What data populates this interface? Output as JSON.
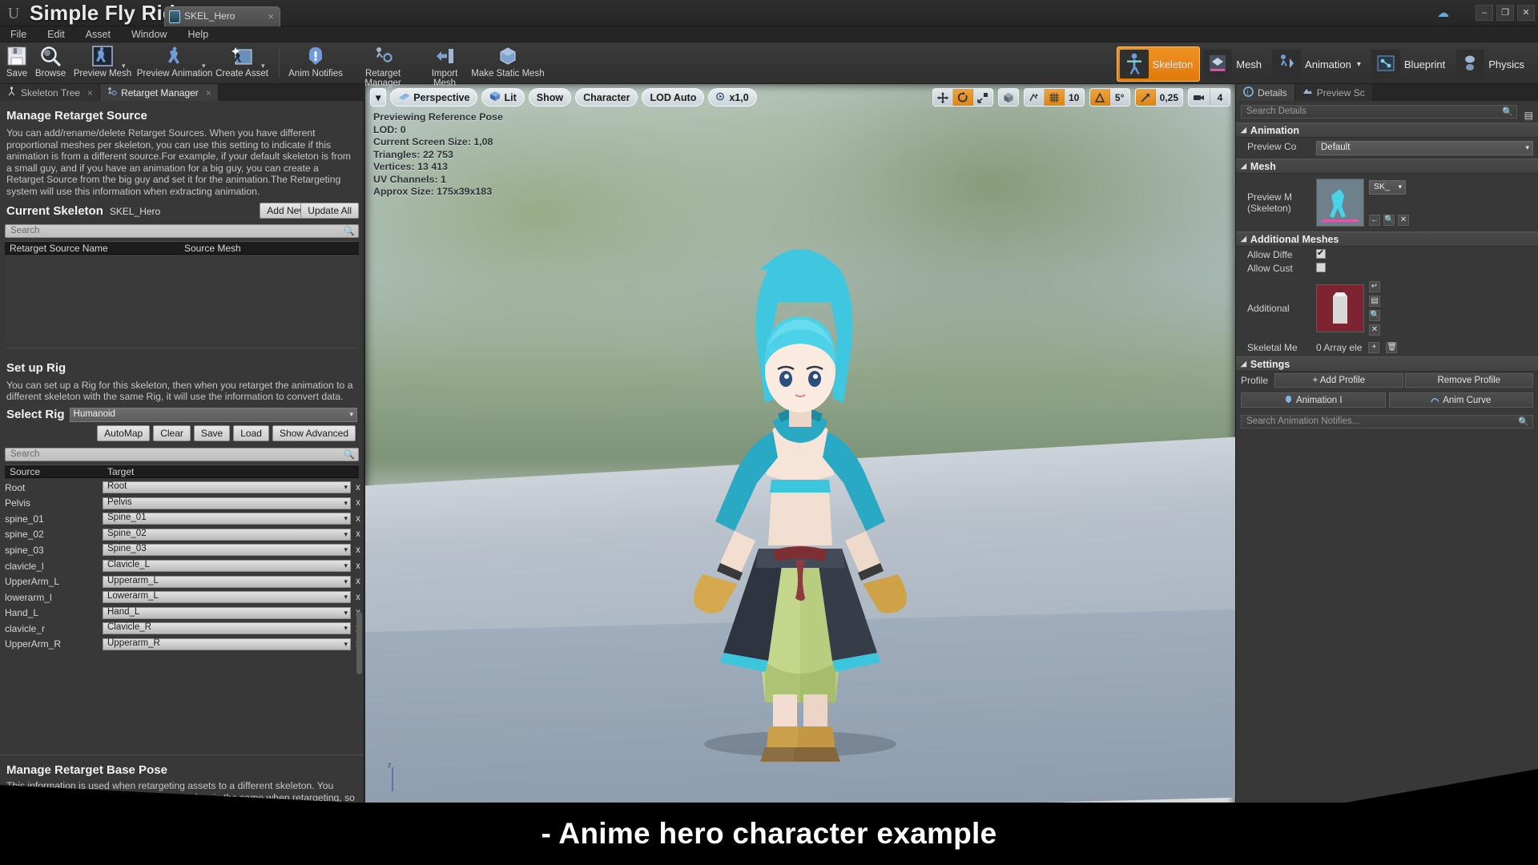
{
  "window": {
    "project_title": "Simple Fly Ride",
    "document_tab": "SKEL_Hero",
    "tab_close": "×",
    "cloud_icon": "cloud-icon",
    "minimize": "–",
    "maximize": "❐",
    "close": "✕"
  },
  "menu": {
    "items": [
      "File",
      "Edit",
      "Asset",
      "Window",
      "Help"
    ]
  },
  "toolbar": {
    "items": [
      {
        "label": "Save",
        "icon": "save-icon",
        "caret": false
      },
      {
        "label": "Browse",
        "icon": "browse-magnifier-icon",
        "caret": false
      },
      {
        "label": "Preview Mesh",
        "icon": "preview-mesh-icon",
        "caret": true
      },
      {
        "label": "Preview Animation",
        "icon": "preview-animation-icon",
        "caret": true
      },
      {
        "label": "Create Asset",
        "icon": "create-asset-icon",
        "caret": true
      },
      {
        "label": "Anim Notifies",
        "icon": "anim-notifies-icon",
        "caret": false
      },
      {
        "label": "Retarget Manager",
        "icon": "retarget-manager-icon",
        "caret": false
      },
      {
        "label": "Import Mesh",
        "icon": "import-mesh-icon",
        "caret": false
      },
      {
        "label": "Make Static Mesh",
        "icon": "make-static-mesh-icon",
        "caret": false
      }
    ],
    "modes": [
      {
        "label": "Skeleton",
        "icon": "skeleton-mode-icon",
        "active": true,
        "caret": false
      },
      {
        "label": "Mesh",
        "icon": "mesh-mode-icon",
        "active": false,
        "caret": false
      },
      {
        "label": "Animation",
        "icon": "animation-mode-icon",
        "active": false,
        "caret": true
      },
      {
        "label": "Blueprint",
        "icon": "blueprint-mode-icon",
        "active": false,
        "caret": false
      },
      {
        "label": "Physics",
        "icon": "physics-mode-icon",
        "active": false,
        "caret": false
      }
    ]
  },
  "left_panel": {
    "tabs": [
      {
        "label": "Skeleton Tree",
        "icon": "skeleton-tree-icon",
        "active": false,
        "close": "×"
      },
      {
        "label": "Retarget Manager",
        "icon": "retarget-manager-icon",
        "active": true,
        "close": "×"
      }
    ],
    "retarget_source": {
      "title": "Manage Retarget Source",
      "description": "You can add/rename/delete Retarget Sources. When you have different proportional meshes per skeleton, you can use this setting to indicate if this animation is from a different source.For example, if your default skeleton is from a small guy, and if you have an animation for a big guy, you can create a Retarget Source from the big guy and set it for the animation.The Retargeting system will use this information when extracting animation.",
      "current_skeleton_label": "Current Skeleton",
      "current_skeleton_value": "SKEL_Hero",
      "add_new_button": "Add New",
      "update_all_button": "Update All",
      "search_placeholder": "Search",
      "columns": [
        "Retarget Source Name",
        "Source Mesh"
      ],
      "rows": []
    },
    "setup_rig": {
      "title": "Set up Rig",
      "description": "You can set up a Rig for this skeleton, then when you retarget the animation to a different skeleton with the same Rig, it will use the information to convert data.",
      "select_rig_label": "Select Rig",
      "select_rig_value": "Humanoid",
      "buttons": [
        "AutoMap",
        "Clear",
        "Save",
        "Load",
        "Show Advanced"
      ],
      "search_placeholder": "Search",
      "columns": [
        "Source",
        "Target"
      ],
      "clear_cell": "x",
      "mappings": [
        {
          "source": "Root",
          "target": "Root"
        },
        {
          "source": "Pelvis",
          "target": "Pelvis"
        },
        {
          "source": "spine_01",
          "target": "Spine_01"
        },
        {
          "source": "spine_02",
          "target": "Spine_02"
        },
        {
          "source": "spine_03",
          "target": "Spine_03"
        },
        {
          "source": "clavicle_l",
          "target": "Clavicle_L"
        },
        {
          "source": "UpperArm_L",
          "target": "Upperarm_L"
        },
        {
          "source": "lowerarm_l",
          "target": "Lowerarm_L"
        },
        {
          "source": "Hand_L",
          "target": "Hand_L"
        },
        {
          "source": "clavicle_r",
          "target": "Clavicle_R"
        },
        {
          "source": "UpperArm_R",
          "target": "Upperarm_R"
        }
      ]
    },
    "base_pose": {
      "title": "Manage Retarget Base Pose",
      "description": "This information is used when retargeting assets to a different skeleton. You need to make sure the ref pose of both meshes is the same when retargeting, so you can see the pose and edit using the bone transform widget, and click the Save button."
    }
  },
  "viewport": {
    "toolbar_left": [
      {
        "label": "",
        "icon": "chevron-down-icon"
      },
      {
        "label": "Perspective",
        "icon": "perspective-camera-icon"
      },
      {
        "label": "Lit",
        "icon": "lit-cube-icon"
      },
      {
        "label": "Show",
        "icon": ""
      },
      {
        "label": "Character",
        "icon": ""
      },
      {
        "label": "LOD Auto",
        "icon": ""
      },
      {
        "label": "x1,0",
        "icon": "playrate-icon"
      }
    ],
    "toolbar_right": [
      {
        "label": "",
        "icon": "move-tool-icon",
        "on": false
      },
      {
        "label": "",
        "icon": "rotate-tool-icon",
        "on": true
      },
      {
        "label": "",
        "icon": "scale-tool-icon",
        "on": false
      },
      {
        "label": "",
        "icon": "world-space-icon",
        "on": false
      },
      {
        "label": "",
        "icon": "surface-snap-icon",
        "on": false
      },
      {
        "label": "",
        "icon": "grid-snap-icon",
        "on": true
      },
      {
        "label": "10",
        "icon": "grid-size-value",
        "on": false
      },
      {
        "label": "",
        "icon": "angle-snap-icon",
        "on": true
      },
      {
        "label": "5°",
        "icon": "angle-size-value",
        "on": false
      },
      {
        "label": "",
        "icon": "scale-snap-icon",
        "on": true
      },
      {
        "label": "0,25",
        "icon": "scale-size-value",
        "on": false
      },
      {
        "label": "",
        "icon": "camera-speed-icon",
        "on": false
      },
      {
        "label": "4",
        "icon": "camera-speed-value",
        "on": false
      }
    ],
    "stats": [
      "Previewing Reference Pose",
      "LOD: 0",
      "Current Screen Size: 1,08",
      "Triangles: 22 753",
      "Vertices: 13 413",
      "UV Channels: 1",
      "Approx Size: 175x39x183"
    ],
    "axis_label": "z"
  },
  "right_panel": {
    "tabs": [
      {
        "label": "Details",
        "icon": "details-icon",
        "active": true
      },
      {
        "label": "Preview Sc",
        "icon": "preview-scene-icon",
        "active": false
      }
    ],
    "search_placeholder": "Search Details",
    "grid_icon": "list-view-icon",
    "categories": [
      {
        "name": "Animation",
        "rows": [
          {
            "label": "Preview Co",
            "type": "combo",
            "value": "Default"
          }
        ]
      },
      {
        "name": "Mesh",
        "rows": [
          {
            "label": "Preview M\n(Skeleton)",
            "type": "thumb-asset",
            "value": "SK_",
            "thumb": "mesh"
          }
        ]
      },
      {
        "name": "Additional Meshes",
        "rows": [
          {
            "label": "Allow Diffe",
            "type": "checkbox",
            "value": true
          },
          {
            "label": "Allow Cust",
            "type": "checkbox",
            "value": false
          },
          {
            "label": "Additional",
            "type": "thumb-asset",
            "value": "",
            "thumb": "red"
          },
          {
            "label": "Skeletal Me",
            "type": "array",
            "value": "0 Array ele"
          }
        ]
      },
      {
        "name": "Settings",
        "rows": [
          {
            "label": "Profile",
            "type": "profile-row",
            "value": "",
            "buttons": [
              "+ Add Profile",
              "Remove Profile"
            ]
          }
        ]
      }
    ],
    "notify_tabs": [
      {
        "label": "Animation I",
        "icon": "anim-notify-icon"
      },
      {
        "label": "Anim Curve",
        "icon": "anim-curve-icon"
      }
    ],
    "notify_search_placeholder": "Search Animation Notifies..."
  },
  "caption": "- Anime hero character example"
}
